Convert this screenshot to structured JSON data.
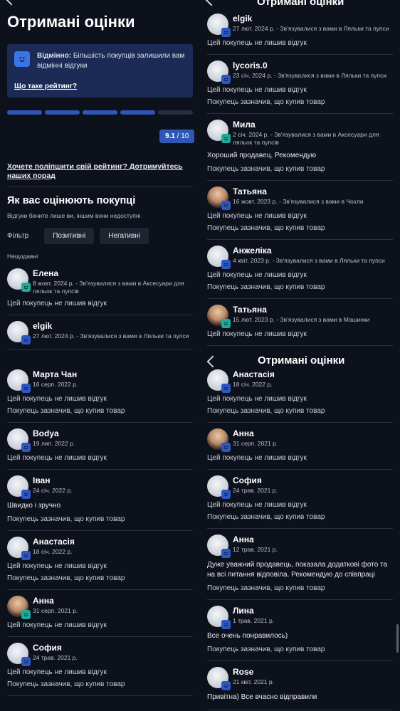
{
  "texts": {
    "page_title": "Отримані оцінки",
    "info_bold": "Відмінно:",
    "info_text": " Більшість покупців залишили вам відмінні відгуки",
    "info_link": "Що таке рейтинг?",
    "rating_value": "9.1",
    "rating_max": " / 10",
    "improve_link": "Хочете поліпшити свій рейтинг? Дотримуйтесь наших порад",
    "section_title": "Як вас оцінюють покупці",
    "section_note": "Відгуки бачите лише ви, іншим вони недоступні",
    "filter_label": "Фільтр",
    "filter_positive": "Позитивні",
    "filter_negative": "Негативні",
    "recent_label": "Нещодавні"
  },
  "rating_fraction": 0.91,
  "colors": {
    "background": "#0d111b",
    "accent": "#2f57b6",
    "card": "#1b2b55",
    "badge_green": "#1fa99a"
  },
  "icons": [
    "back-arrow-icon",
    "smiley-badge-icon",
    "avatar-placeholder-icon"
  ],
  "p1": [
    {
      "name": "Елена",
      "meta": "8 жовт. 2024 р. - Зв'язувалися з вами в Аксесуари для ляльок та пупсів",
      "lines": [
        "Цей покупець не лишив відгук"
      ]
    },
    {
      "name": "elgik",
      "meta": "27 лют. 2024 р. - Зв'язувалися з вами в Ляльки та пупси",
      "lines": []
    }
  ],
  "p2": [
    {
      "name": "elgik",
      "meta": "27 лют. 2024 р. - Зв'язувалися з вами в Ляльки та пупси",
      "lines": [
        "Цей покупець не лишив відгук"
      ]
    },
    {
      "name": "lycoris.0",
      "meta": "23 січ. 2024 р. - Зв'язувалися з вами в Ляльки та пупси",
      "lines": [
        "Цей покупець не лишив відгук",
        "Покупець зазначив, що купив товар"
      ]
    },
    {
      "name": "Мила",
      "meta": "2 січ. 2024 р. - Зв'язувалися з вами в Аксесуари для ляльок та пупсів",
      "text": "Хороший продавец. Рекомендую",
      "lines": [
        "Покупець зазначив, що купив товар"
      ]
    },
    {
      "name": "Татьяна",
      "meta": "16 жовт. 2023 р. - Зв'язувалися з вами в Чохли",
      "lines": [
        "Цей покупець не лишив відгук",
        "Покупець зазначив, що купив товар"
      ]
    },
    {
      "name": "Анжеліка",
      "meta": "4 квіт. 2023 р. - Зв'язувалися з вами в Ляльки та пупси",
      "lines": [
        "Цей покупець не лишив відгук",
        "Покупець зазначив, що купив товар"
      ]
    },
    {
      "name": "Татьяна",
      "meta": "15 лют. 2023 р. - Зв'язувалися з вами в Машинки",
      "lines": [
        "Цей покупець не лишив відгук"
      ]
    }
  ],
  "p3": [
    {
      "name": "Марта Чан",
      "meta": "16 серп. 2022 р.",
      "lines": [
        "Цей покупець не лишив відгук",
        "Покупець зазначив, що купив товар"
      ]
    },
    {
      "name": "Bodya",
      "meta": "19 лип. 2022 р.",
      "lines": [
        "Цей покупець не лишив відгук"
      ]
    },
    {
      "name": "Іван",
      "meta": "24 січ. 2022 р.",
      "text": "Швидко і зручно",
      "lines": [
        "Покупець зазначив, що купив товар"
      ]
    },
    {
      "name": "Анастасія",
      "meta": "18 січ. 2022 р.",
      "lines": [
        "Цей покупець не лишив відгук",
        "Покупець зазначив, що купив товар"
      ]
    },
    {
      "name": "Анна",
      "meta": "31 серп. 2021 р.",
      "lines": [
        "Цей покупець не лишив відгук"
      ]
    },
    {
      "name": "София",
      "meta": "24 трав. 2021 р.",
      "lines": [
        "Цей покупець не лишив відгук",
        "Покупець зазначив, що купив товар"
      ]
    }
  ],
  "p4": [
    {
      "name": "Анастасія",
      "meta": "18 січ. 2022 р.",
      "lines": [
        "Цей покупець не лишив відгук",
        "Покупець зазначив, що купив товар"
      ]
    },
    {
      "name": "Анна",
      "meta": "31 серп. 2021 р.",
      "lines": [
        "Цей покупець не лишив відгук"
      ]
    },
    {
      "name": "София",
      "meta": "24 трав. 2021 р.",
      "lines": [
        "Цей покупець не лишив відгук",
        "Покупець зазначив, що купив товар"
      ]
    },
    {
      "name": "Анна",
      "meta": "12 трав. 2021 р.",
      "text": "Дуже уважний продавець, показала додаткові фото та на всі питання відповіла. Рекомендую до співпраці",
      "lines": [
        "Покупець зазначив, що купив товар"
      ]
    },
    {
      "name": "Лина",
      "meta": "1 трав. 2021 р.",
      "text": "Все очень понравилось)",
      "lines": [
        "Покупець зазначив, що купив товар"
      ]
    },
    {
      "name": "Rose",
      "meta": "21 квіт. 2021 р.",
      "text": "Привітна) Все вчасно відправили",
      "lines": []
    }
  ]
}
